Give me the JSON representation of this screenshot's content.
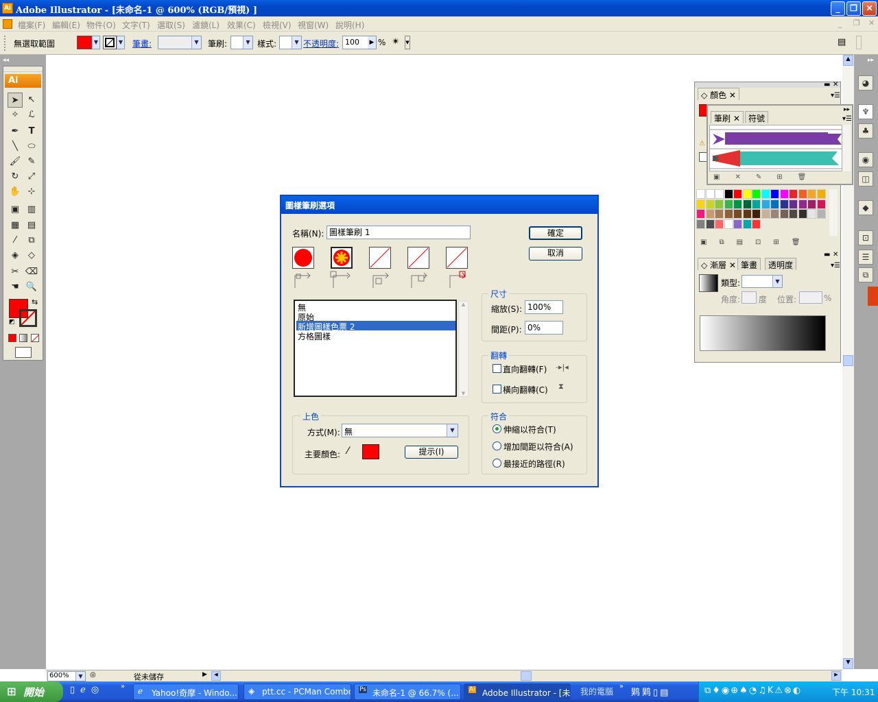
{
  "window": {
    "title": "Adobe Illustrator - [未命名-1 @ 600% (RGB/預視) ]",
    "app_icon": "Ai"
  },
  "menu": [
    "檔案(F)",
    "編輯(E)",
    "物件(O)",
    "文字(T)",
    "選取(S)",
    "濾鏡(L)",
    "效果(C)",
    "檢視(V)",
    "視窗(W)",
    "說明(H)"
  ],
  "control": {
    "selection": "無選取範圍",
    "stroke_link": "筆畫:",
    "brush_label": "筆刷:",
    "style_label": "樣式:",
    "opacity_link": "不透明度:",
    "opacity_value": "100",
    "percent": "%"
  },
  "dialog": {
    "title": "圖樣筆刷選項",
    "name_label": "名稱(N):",
    "name_value": "圖樣筆刷 1",
    "ok": "確定",
    "cancel": "取消",
    "list_items": [
      "無",
      "原始",
      "新增圖樣色票 2",
      "方格圖樣"
    ],
    "selected_index": 2,
    "size_group": "尺寸",
    "scale_label": "縮放(S):",
    "scale_value": "100%",
    "spacing_label": "間距(P):",
    "spacing_value": "0%",
    "flip_group": "翻轉",
    "flip_v": "直向翻轉(F)",
    "flip_h": "橫向翻轉(C)",
    "colorize_group": "上色",
    "method_label": "方式(M):",
    "method_value": "無",
    "key_color_label": "主要顏色:",
    "tips": "提示(I)",
    "fit_group": "符合",
    "fit_options": [
      "伸縮以符合(T)",
      "增加間距以符合(A)",
      "最接近的路徑(R)"
    ],
    "fit_selected": 0
  },
  "panels": {
    "color_tab": "顏色",
    "brush_tabs": [
      "筆刷",
      "符號"
    ],
    "gradient_tabs": [
      "漸層",
      "筆畫",
      "透明度"
    ],
    "gradient_type_label": "類型:",
    "angle_label": "角度:",
    "degree": "度",
    "location_label": "位置:",
    "percent": "%"
  },
  "status": {
    "zoom": "600%",
    "save_state": "從未儲存"
  },
  "taskbar": {
    "start": "開始",
    "tasks": [
      "Yahoo!奇摩 - Windo...",
      "ptt.cc - PCMan Combo",
      "未命名-1 @ 66.7% (...",
      "Adobe Illustrator - [未..."
    ],
    "my_computer": "我的電腦",
    "clock": "下午 10:31"
  },
  "colors": {
    "fill": "#ff0000",
    "accent": "#0a48c8"
  }
}
